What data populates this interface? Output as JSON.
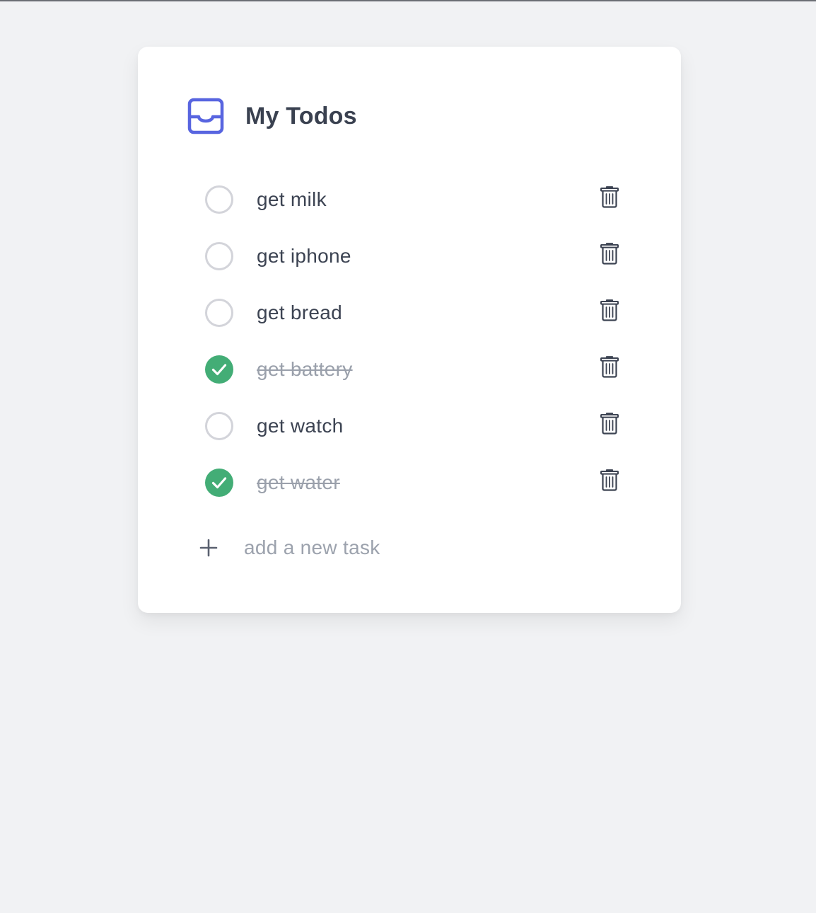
{
  "app": {
    "title": "My Todos",
    "icon": "inbox-icon",
    "accent_color": "#5865e0"
  },
  "todos": [
    {
      "text": "get milk",
      "done": false
    },
    {
      "text": "get iphone",
      "done": false
    },
    {
      "text": "get bread",
      "done": false
    },
    {
      "text": "get battery",
      "done": true
    },
    {
      "text": "get watch",
      "done": false
    },
    {
      "text": "get water",
      "done": true
    }
  ],
  "icons": {
    "check": "checkmark-icon",
    "delete": "trash-icon",
    "add": "plus-icon"
  },
  "colors": {
    "done": "#43ad76",
    "unchecked_border": "#d3d4da",
    "text": "#3c4352",
    "muted": "#9aa0ab",
    "background": "#f1f2f4"
  },
  "new_task": {
    "placeholder": "add a new task",
    "value": ""
  }
}
